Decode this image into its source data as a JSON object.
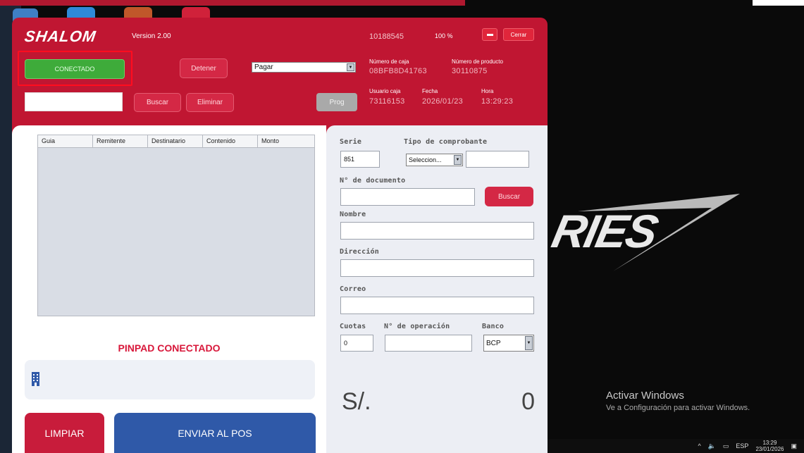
{
  "app": {
    "logo": "SHALOM",
    "version": "Version 2.00",
    "code": "10188545",
    "zoom": "100 %",
    "close_label": "Cerrar",
    "status_label": "CONECTADO",
    "stop_label": "Detener",
    "action_select": "Pagar",
    "search_label": "Buscar",
    "delete_label": "Eliminar",
    "prog_label": "Prog",
    "cash_register_label": "Número de caja",
    "cash_register_value": "08BFB8D41763",
    "product_number_label": "Número de producto",
    "product_number_value": "30110875",
    "cashier_label": "Usuario caja",
    "cashier_value": "73116153",
    "date_label": "Fecha",
    "date_value": "2026/01/23",
    "time_label": "Hora",
    "time_value": "13:29:23"
  },
  "table": {
    "columns": [
      "Guia",
      "Remitente",
      "Destinatario",
      "Contenido",
      "Monto"
    ]
  },
  "pinpad": {
    "status": "PINPAD CONECTADO"
  },
  "actions": {
    "clear_label": "LIMPIAR",
    "send_label": "ENVIAR AL POS"
  },
  "form": {
    "serie_label": "Serie",
    "serie_value": "851",
    "voucher_type_label": "Tipo de comprobante",
    "voucher_type_value": "Seleccion...",
    "document_label": "N° de documento",
    "document_search_label": "Buscar",
    "name_label": "Nombre",
    "address_label": "Dirección",
    "email_label": "Correo",
    "installments_label": "Cuotas",
    "installments_value": "0",
    "operation_label": "N° de operación",
    "bank_label": "Banco",
    "bank_value": "BCP",
    "currency": "S/.",
    "amount": "0"
  },
  "desktop": {
    "wallpaper_text": "RIES",
    "activate_title": "Activar Windows",
    "activate_sub": "Ve a Configuración para activar Windows.",
    "lang": "ESP",
    "clock_time": "13:29",
    "clock_date": "23/01/2026"
  },
  "colors": {
    "primary": "#c01632",
    "connected": "#3eab3a",
    "send": "#2f59a8"
  }
}
